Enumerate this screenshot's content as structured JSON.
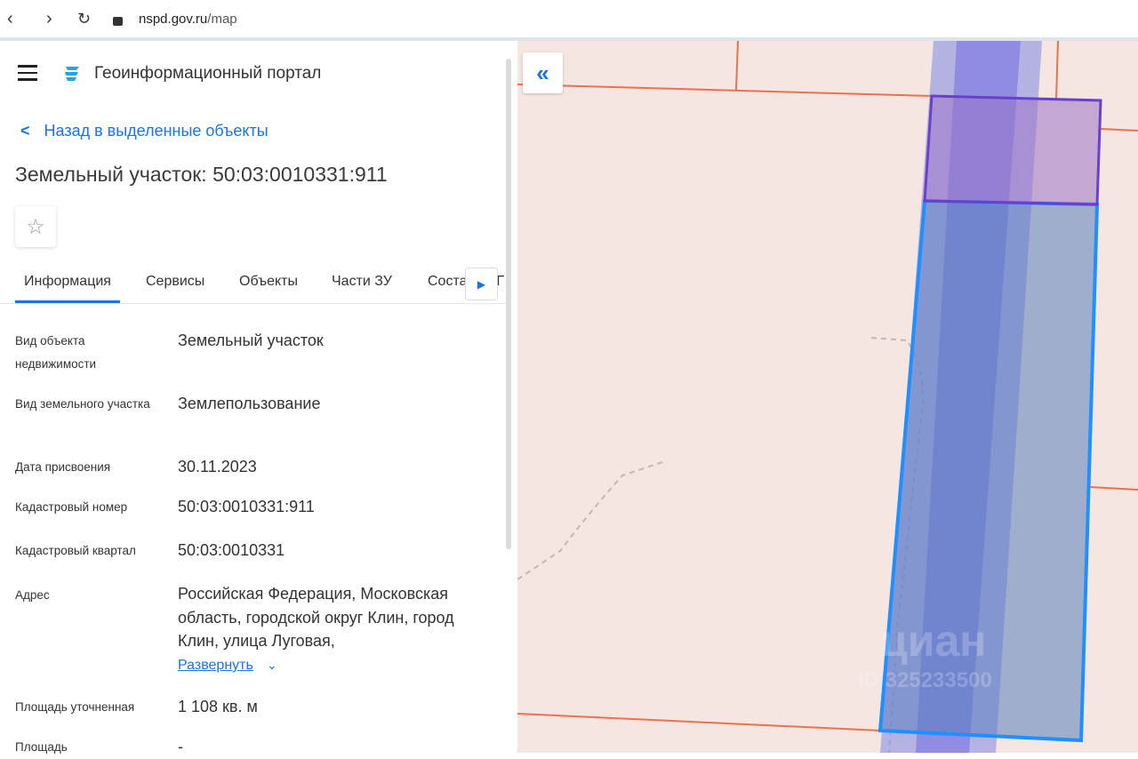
{
  "browser": {
    "url_host": "nspd.gov.ru",
    "url_path": "/map"
  },
  "header": {
    "title": "Геоинформационный портал"
  },
  "back_link": "Назад в выделенные объекты",
  "heading": "Земельный участок: 50:03:0010331:911",
  "tabs": [
    {
      "label": "Информация",
      "active": true
    },
    {
      "label": "Сервисы"
    },
    {
      "label": "Объекты"
    },
    {
      "label": "Части ЗУ"
    },
    {
      "label": "Состав ЕЗП"
    }
  ],
  "tab_visible_partial": "Соста",
  "fields": [
    {
      "label": "Вид объекта недвижимости",
      "value": "Земельный участок"
    },
    {
      "label": "Вид земельного участка",
      "value": "Землепользование"
    },
    {
      "label": "Дата присвоения",
      "value": "30.11.2023"
    },
    {
      "label": "Кадастровый номер",
      "value": "50:03:0010331:911"
    },
    {
      "label": "Кадастровый квартал",
      "value": "50:03:0010331"
    },
    {
      "label": "Адрес",
      "value": "Российская Федерация, Московская область, городской округ Клин, город Клин, улица Луговая,"
    },
    {
      "label": "Площадь уточненная",
      "value": "1 108 кв. м"
    },
    {
      "label": "Площадь",
      "value": "-"
    }
  ],
  "expand_label": "Развернуть",
  "watermark": {
    "brand": "циан",
    "id": "ID 325233500"
  },
  "colors": {
    "accent": "#1a73e8",
    "map_bg": "#f5e6e1",
    "parcel_border": "#1e90ff",
    "selected_border": "#6a3fd0",
    "boundary": "#e8734f"
  }
}
